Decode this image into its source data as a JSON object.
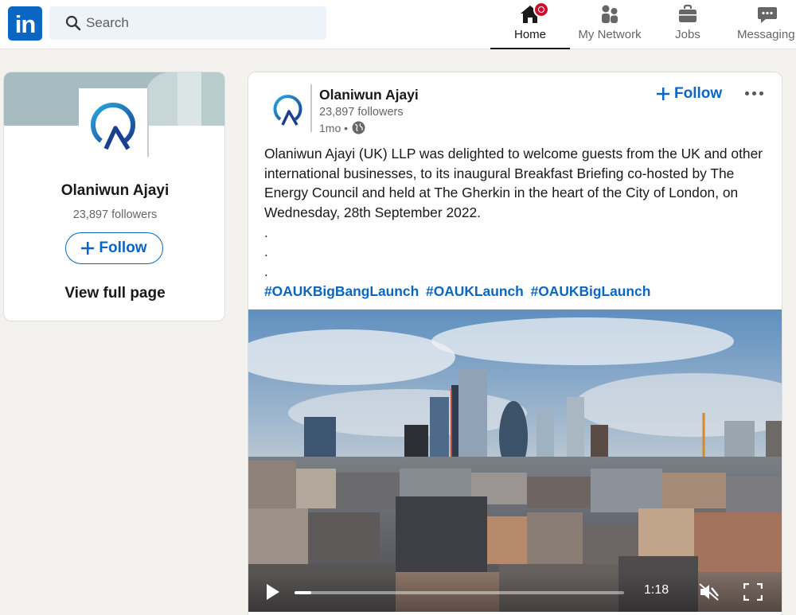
{
  "nav": {
    "search_placeholder": "Search",
    "items": [
      {
        "label": "Home",
        "icon": "home-icon",
        "active": true
      },
      {
        "label": "My Network",
        "icon": "people-icon"
      },
      {
        "label": "Jobs",
        "icon": "briefcase-icon"
      },
      {
        "label": "Messaging",
        "icon": "chat-icon"
      }
    ],
    "brand_color": "#0a66c2",
    "notification_color": "#cb112d"
  },
  "company_card": {
    "name": "Olaniwun Ajayi",
    "followers": "23,897 followers",
    "follow_label": "Follow",
    "view_full_page": "View full page"
  },
  "post": {
    "author": "Olaniwun Ajayi",
    "followers": "23,897 followers",
    "time": "1mo •",
    "visibility_icon": "globe-icon",
    "follow_label": "Follow",
    "text": "Olaniwun Ajayi (UK) LLP was delighted to welcome guests from the UK and other international businesses, to its inaugural Breakfast Briefing co-hosted by The Energy Council and held at The Gherkin in the heart of the City of London, on Wednesday, 28th September 2022.",
    "dots": [
      ".",
      ".",
      "."
    ],
    "hashtags": [
      "#OAUKBigBangLaunch",
      "#OAUKLaunch",
      "#OAUKBigLaunch"
    ],
    "video": {
      "duration": "1:18",
      "progress": 0.05,
      "muted": true
    }
  }
}
